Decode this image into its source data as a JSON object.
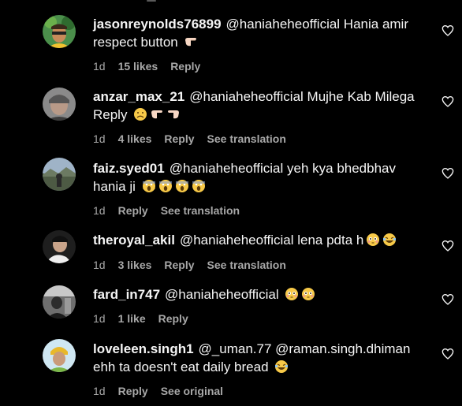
{
  "comments": [
    {
      "username": "jasonreynolds76899",
      "text": "@haniaheheofficial Hania amir respect button",
      "emojis": [
        "point-right-emoji"
      ],
      "time": "1d",
      "likes": "15 likes",
      "reply": "Reply",
      "translation": ""
    },
    {
      "username": "anzar_max_21",
      "text": "@haniaheheofficial Mujhe Kab Milega Reply",
      "emojis": [
        "frowning-face-emoji",
        "point-right-emoji",
        "point-left-emoji"
      ],
      "time": "1d",
      "likes": "4 likes",
      "reply": "Reply",
      "translation": "See translation"
    },
    {
      "username": "faiz.syed01",
      "text": "@haniaheheofficial yeh kya bhedbhav hania ji",
      "emojis": [
        "screaming-face-emoji",
        "screaming-face-emoji",
        "screaming-face-emoji",
        "screaming-face-emoji"
      ],
      "time": "1d",
      "likes": "",
      "reply": "Reply",
      "translation": "See translation"
    },
    {
      "username": "theroyal_akil",
      "text": "@haniaheheofficial lena pdta h",
      "emojis": [
        "flushed-face-emoji",
        "laughing-face-emoji"
      ],
      "time": "1d",
      "likes": "3 likes",
      "reply": "Reply",
      "translation": "See translation"
    },
    {
      "username": "fard_in747",
      "text": "@haniaheheofficial",
      "emojis": [
        "flushed-face-emoji",
        "flushed-face-emoji"
      ],
      "time": "1d",
      "likes": "1 like",
      "reply": "Reply",
      "translation": ""
    },
    {
      "username": "loveleen.singh1",
      "text": "@_uman.77 @raman.singh.dhiman ehh ta doesn't eat daily bread",
      "emojis": [
        "laughing-face-emoji"
      ],
      "time": "1d",
      "likes": "",
      "reply": "Reply",
      "translation": "See original"
    }
  ]
}
